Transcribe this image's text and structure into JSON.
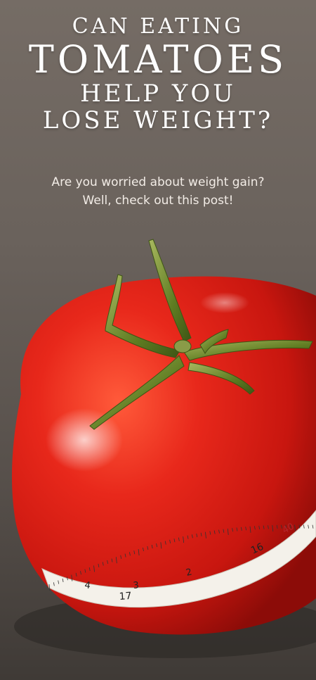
{
  "headline": {
    "line1": "CAN EATING",
    "line2": "TOMATOES",
    "line3": "HELP YOU",
    "line4": "LOSE WEIGHT?"
  },
  "subtitle": {
    "line1": "Are you worried about weight gain?",
    "line2": "Well, check out this post!"
  },
  "tape_labels": [
    "40",
    "16",
    "2",
    "3",
    "17",
    "4"
  ],
  "colors": {
    "background": "#6e665f",
    "tomato": "#e0251a",
    "stem": "#6f8a2c",
    "tape": "#f4f1ea"
  }
}
